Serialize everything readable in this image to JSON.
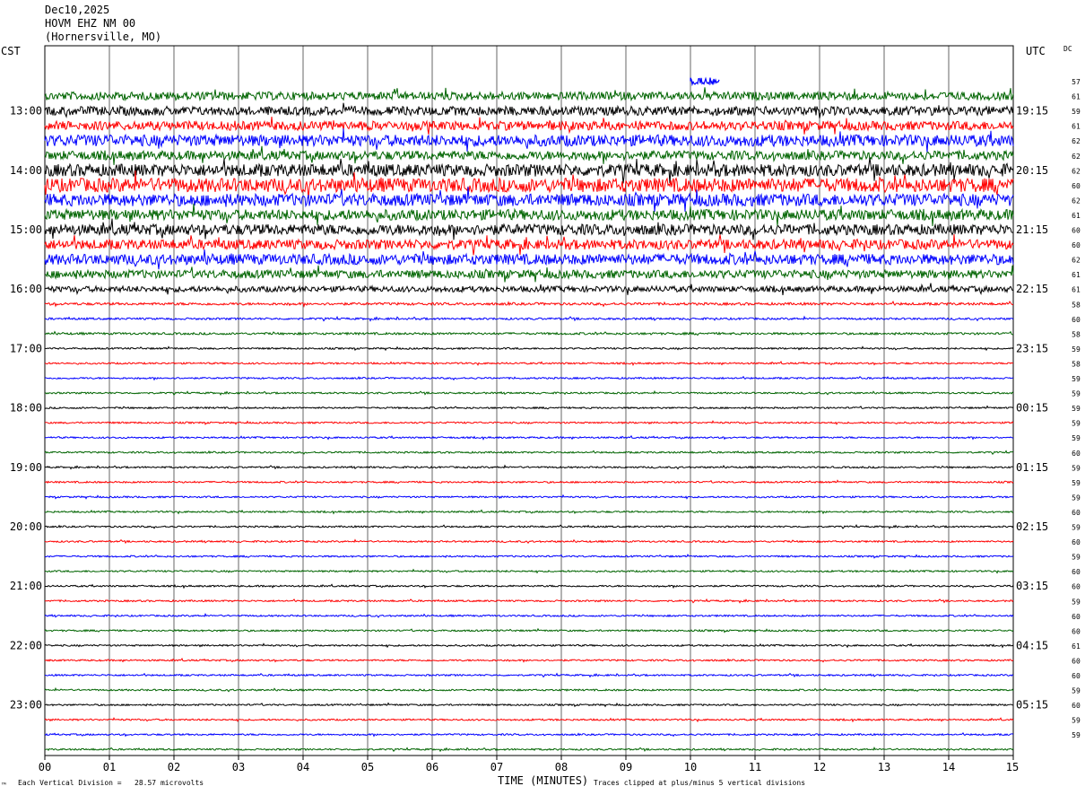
{
  "header": {
    "date": "Dec10,2025",
    "station": "HOVM EHZ NM 00",
    "location": "(Hornersville, MO)"
  },
  "left_tz": "CST",
  "right_tz": "UTC",
  "dc_label": "DC",
  "footer": {
    "logo": "™",
    "scale": "Each Vertical Division =   28.57 microvolts",
    "xlabel": "TIME (MINUTES)",
    "clip_note": "Traces clipped at plus/minus 5 vertical divisions"
  },
  "chart_data": {
    "type": "line",
    "title": "HOVM EHZ NM 00",
    "xlabel": "TIME (MINUTES)",
    "ylabel": "",
    "xlim": [
      0,
      15
    ],
    "x_ticks": [
      "00",
      "01",
      "02",
      "03",
      "04",
      "05",
      "06",
      "07",
      "08",
      "09",
      "10",
      "11",
      "12",
      "13",
      "14",
      "15"
    ],
    "grid": true,
    "colors": {
      "green": "#006400",
      "black": "#000000",
      "red": "#ff0000",
      "blue": "#0000ff"
    },
    "left_hour_labels": [
      "13:00",
      "14:00",
      "15:00",
      "16:00",
      "17:00",
      "18:00",
      "19:00",
      "20:00",
      "21:00",
      "22:00",
      "23:00"
    ],
    "right_hour_labels": [
      "19:15",
      "20:15",
      "21:15",
      "22:15",
      "23:15",
      "00:15",
      "01:15",
      "02:15",
      "03:15",
      "04:15",
      "05:15"
    ],
    "traces": [
      {
        "color": "green",
        "dc": "57",
        "amplitude": 0.5
      },
      {
        "color": "black",
        "dc": "61",
        "amplitude": 0.55
      },
      {
        "color": "red",
        "dc": "59",
        "amplitude": 0.55
      },
      {
        "color": "blue",
        "dc": "61",
        "amplitude": 0.7
      },
      {
        "color": "green",
        "dc": "62",
        "amplitude": 0.55
      },
      {
        "color": "black",
        "dc": "62",
        "amplitude": 0.75
      },
      {
        "color": "red",
        "dc": "62",
        "amplitude": 0.85
      },
      {
        "color": "blue",
        "dc": "60",
        "amplitude": 0.75
      },
      {
        "color": "green",
        "dc": "62",
        "amplitude": 0.65
      },
      {
        "color": "black",
        "dc": "61",
        "amplitude": 0.65
      },
      {
        "color": "red",
        "dc": "60",
        "amplitude": 0.6
      },
      {
        "color": "blue",
        "dc": "60",
        "amplitude": 0.65
      },
      {
        "color": "green",
        "dc": "62",
        "amplitude": 0.5
      },
      {
        "color": "black",
        "dc": "61",
        "amplitude": 0.35
      },
      {
        "color": "red",
        "dc": "61",
        "amplitude": 0.15
      },
      {
        "color": "blue",
        "dc": "58",
        "amplitude": 0.12
      },
      {
        "color": "green",
        "dc": "60",
        "amplitude": 0.13
      },
      {
        "color": "black",
        "dc": "58",
        "amplitude": 0.1
      },
      {
        "color": "red",
        "dc": "59",
        "amplitude": 0.1
      },
      {
        "color": "blue",
        "dc": "58",
        "amplitude": 0.1
      },
      {
        "color": "green",
        "dc": "59",
        "amplitude": 0.1
      },
      {
        "color": "black",
        "dc": "59",
        "amplitude": 0.1
      },
      {
        "color": "red",
        "dc": "59",
        "amplitude": 0.1
      },
      {
        "color": "blue",
        "dc": "59",
        "amplitude": 0.1
      },
      {
        "color": "green",
        "dc": "59",
        "amplitude": 0.1
      },
      {
        "color": "black",
        "dc": "60",
        "amplitude": 0.1
      },
      {
        "color": "red",
        "dc": "59",
        "amplitude": 0.1
      },
      {
        "color": "blue",
        "dc": "59",
        "amplitude": 0.1
      },
      {
        "color": "green",
        "dc": "59",
        "amplitude": 0.1
      },
      {
        "color": "black",
        "dc": "60",
        "amplitude": 0.1
      },
      {
        "color": "red",
        "dc": "59",
        "amplitude": 0.1
      },
      {
        "color": "blue",
        "dc": "60",
        "amplitude": 0.1
      },
      {
        "color": "green",
        "dc": "59",
        "amplitude": 0.1
      },
      {
        "color": "black",
        "dc": "60",
        "amplitude": 0.1
      },
      {
        "color": "red",
        "dc": "60",
        "amplitude": 0.1
      },
      {
        "color": "blue",
        "dc": "59",
        "amplitude": 0.1
      },
      {
        "color": "green",
        "dc": "60",
        "amplitude": 0.1
      },
      {
        "color": "black",
        "dc": "60",
        "amplitude": 0.1
      },
      {
        "color": "red",
        "dc": "61",
        "amplitude": 0.1
      },
      {
        "color": "blue",
        "dc": "60",
        "amplitude": 0.1
      },
      {
        "color": "green",
        "dc": "60",
        "amplitude": 0.1
      },
      {
        "color": "black",
        "dc": "59",
        "amplitude": 0.1
      },
      {
        "color": "red",
        "dc": "60",
        "amplitude": 0.1
      },
      {
        "color": "blue",
        "dc": "59",
        "amplitude": 0.1
      },
      {
        "color": "green",
        "dc": "59",
        "amplitude": 0.1
      }
    ],
    "event_marker": {
      "color": "blue",
      "x_start": 10.0,
      "x_end": 10.45,
      "row": -1
    }
  }
}
